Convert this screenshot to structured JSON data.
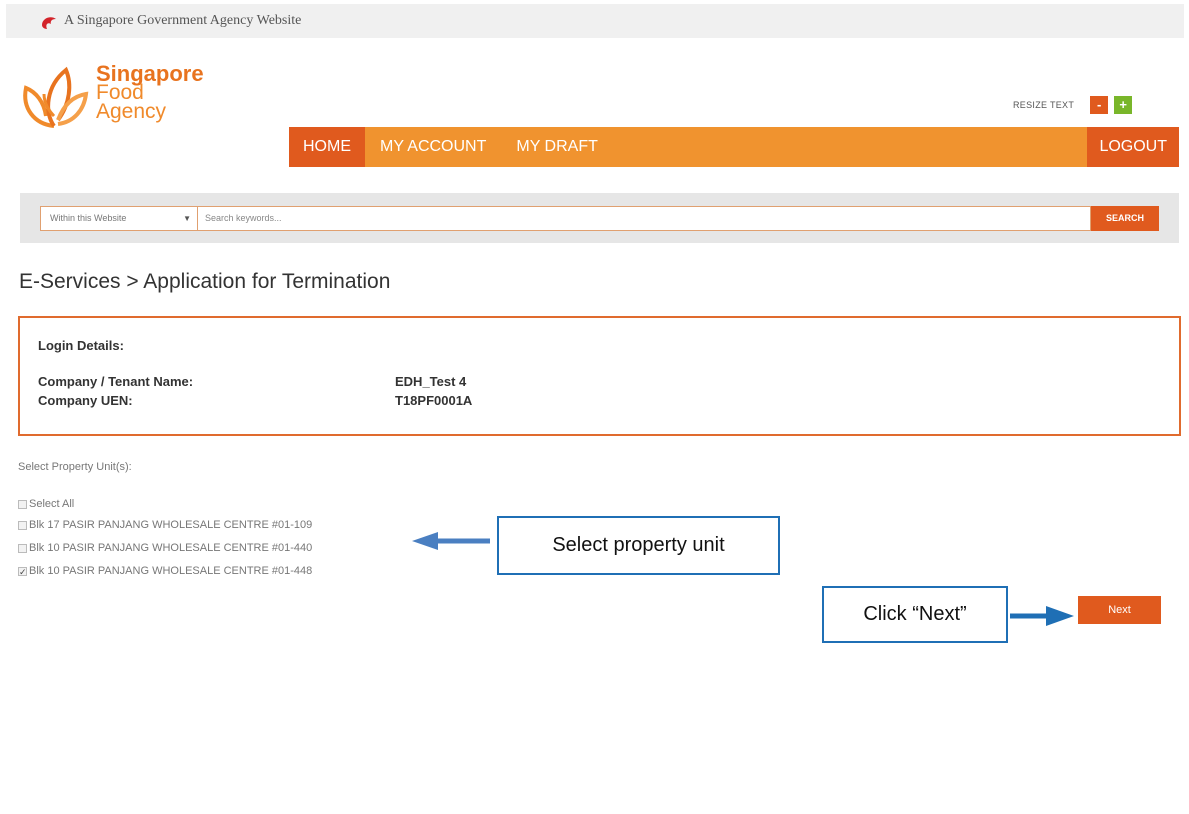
{
  "gov_banner": {
    "text": "A Singapore Government Agency Website",
    "icon": "lion-head-icon"
  },
  "logo": {
    "line1": "Singapore",
    "line2": "Food",
    "line3": "Agency"
  },
  "resize": {
    "label": "RESIZE TEXT",
    "minus": "-",
    "plus": "+"
  },
  "nav": {
    "items": [
      "HOME",
      "MY ACCOUNT",
      "MY DRAFT"
    ],
    "logout": "LOGOUT"
  },
  "search": {
    "scope": "Within this Website",
    "placeholder": "Search keywords...",
    "button": "SEARCH"
  },
  "page_title": "E-Services > Application for Termination",
  "login_details": {
    "header": "Login Details:",
    "company_label": "Company / Tenant Name:",
    "company_value": "EDH_Test 4",
    "uen_label": "Company UEN:",
    "uen_value": "T18PF0001A"
  },
  "units": {
    "label": "Select Property Unit(s):",
    "select_all": "Select All",
    "items": [
      {
        "label": "Blk 17 PASIR PANJANG WHOLESALE CENTRE #01-109",
        "checked": false
      },
      {
        "label": "Blk 10 PASIR PANJANG WHOLESALE CENTRE #01-440",
        "checked": false
      },
      {
        "label": "Blk 10 PASIR PANJANG WHOLESALE CENTRE #01-448",
        "checked": true
      }
    ]
  },
  "callouts": {
    "select_unit": "Select property unit",
    "click_next": "Click “Next”"
  },
  "next_button": "Next",
  "colors": {
    "brand_orange": "#f0932f",
    "accent_red": "#e05a1e",
    "callout_blue": "#1f6fb5"
  }
}
